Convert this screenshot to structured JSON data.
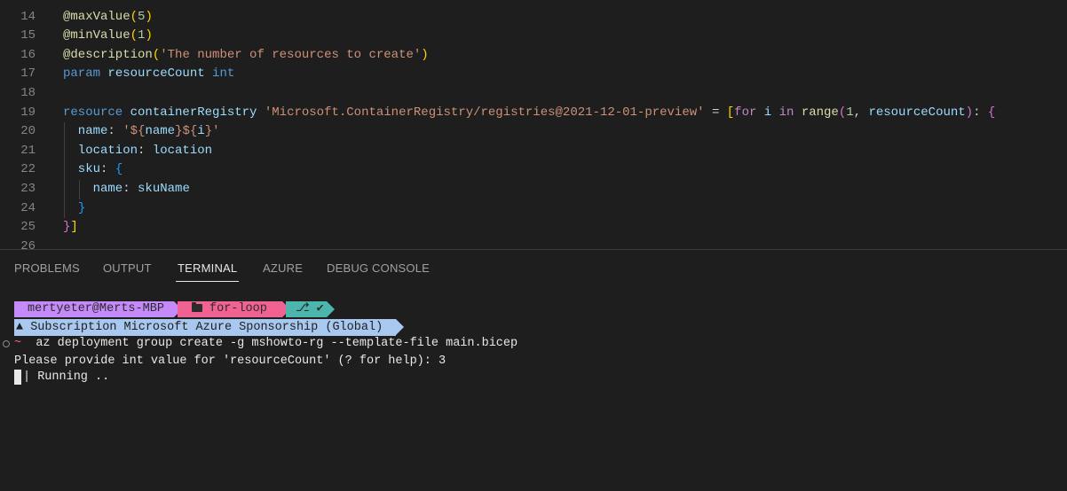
{
  "editor": {
    "lines": [
      {
        "num": "15",
        "tokens": []
      },
      {
        "num": "14",
        "tokens": [
          {
            "t": "@maxValue",
            "c": "t-dec"
          },
          {
            "t": "(",
            "c": "t-b1"
          },
          {
            "t": "5",
            "c": "t-num"
          },
          {
            "t": ")",
            "c": "t-b1"
          }
        ]
      },
      {
        "num": "15",
        "tokens": [
          {
            "t": "@minValue",
            "c": "t-dec"
          },
          {
            "t": "(",
            "c": "t-b1"
          },
          {
            "t": "1",
            "c": "t-num"
          },
          {
            "t": ")",
            "c": "t-b1"
          }
        ]
      },
      {
        "num": "16",
        "tokens": [
          {
            "t": "@description",
            "c": "t-dec"
          },
          {
            "t": "(",
            "c": "t-b1"
          },
          {
            "t": "'The number of resources to create'",
            "c": "t-str"
          },
          {
            "t": ")",
            "c": "t-b1"
          }
        ]
      },
      {
        "num": "17",
        "tokens": [
          {
            "t": "param ",
            "c": "t-kw"
          },
          {
            "t": "resourceCount ",
            "c": "t-id"
          },
          {
            "t": "int",
            "c": "t-kw"
          }
        ]
      },
      {
        "num": "18",
        "tokens": []
      },
      {
        "num": "19",
        "tokens": [
          {
            "t": "resource ",
            "c": "t-kw"
          },
          {
            "t": "containerRegistry ",
            "c": "t-id"
          },
          {
            "t": "'Microsoft.ContainerRegistry/registries@2021-12-01-preview'",
            "c": "t-str"
          },
          {
            "t": " = ",
            "c": "t-plain"
          },
          {
            "t": "[",
            "c": "t-b1"
          },
          {
            "t": "for ",
            "c": "t-ctl"
          },
          {
            "t": "i ",
            "c": "t-id"
          },
          {
            "t": "in ",
            "c": "t-ctl"
          },
          {
            "t": "range",
            "c": "t-fn"
          },
          {
            "t": "(",
            "c": "t-b2"
          },
          {
            "t": "1",
            "c": "t-num"
          },
          {
            "t": ", ",
            "c": "t-plain"
          },
          {
            "t": "resourceCount",
            "c": "t-id"
          },
          {
            "t": ")",
            "c": "t-b2"
          },
          {
            "t": ": ",
            "c": "t-plain"
          },
          {
            "t": "{",
            "c": "t-b2"
          }
        ]
      },
      {
        "num": "20",
        "tokens": [
          {
            "t": "  name",
            "c": "t-id"
          },
          {
            "t": ": ",
            "c": "t-plain"
          },
          {
            "t": "'${",
            "c": "t-str"
          },
          {
            "t": "name",
            "c": "t-id"
          },
          {
            "t": "}${",
            "c": "t-str"
          },
          {
            "t": "i",
            "c": "t-id"
          },
          {
            "t": "}'",
            "c": "t-str"
          }
        ]
      },
      {
        "num": "21",
        "tokens": [
          {
            "t": "  location",
            "c": "t-id"
          },
          {
            "t": ": ",
            "c": "t-plain"
          },
          {
            "t": "location",
            "c": "t-id"
          }
        ]
      },
      {
        "num": "22",
        "tokens": [
          {
            "t": "  sku",
            "c": "t-id"
          },
          {
            "t": ": ",
            "c": "t-plain"
          },
          {
            "t": "{",
            "c": "t-b3"
          }
        ]
      },
      {
        "num": "23",
        "tokens": [
          {
            "t": "    name",
            "c": "t-id"
          },
          {
            "t": ": ",
            "c": "t-plain"
          },
          {
            "t": "skuName",
            "c": "t-id"
          }
        ]
      },
      {
        "num": "24",
        "tokens": [
          {
            "t": "  ",
            "c": "t-plain"
          },
          {
            "t": "}",
            "c": "t-b3"
          }
        ]
      },
      {
        "num": "25",
        "tokens": [
          {
            "t": "}",
            "c": "t-b2"
          },
          {
            "t": "]",
            "c": "t-b1"
          }
        ]
      },
      {
        "num": "26",
        "tokens": []
      }
    ]
  },
  "panel": {
    "tabs": [
      {
        "label": "PROBLEMS",
        "active": false
      },
      {
        "label": "OUTPUT",
        "active": false
      },
      {
        "label": "TERMINAL",
        "active": true
      },
      {
        "label": "AZURE",
        "active": false
      },
      {
        "label": "DEBUG CONSOLE",
        "active": false
      }
    ]
  },
  "terminal": {
    "prompt_user": "mertyeter@Merts-MBP",
    "prompt_dir": "for-loop",
    "prompt_git": "✔",
    "subscription": "Subscription Microsoft Azure Sponsorship (Global)",
    "prompt_symbol": "~",
    "command": "az deployment group create -g mshowto-rg --template-file main.bicep",
    "prompt_question": "Please provide int value for 'resourceCount' (? for help): 3",
    "status": "| Running .."
  },
  "colors": {
    "user_segment": "#c58af9",
    "dir_segment": "#f06292",
    "git_segment": "#4db6ac",
    "subscription_segment": "#a8c8f0"
  }
}
